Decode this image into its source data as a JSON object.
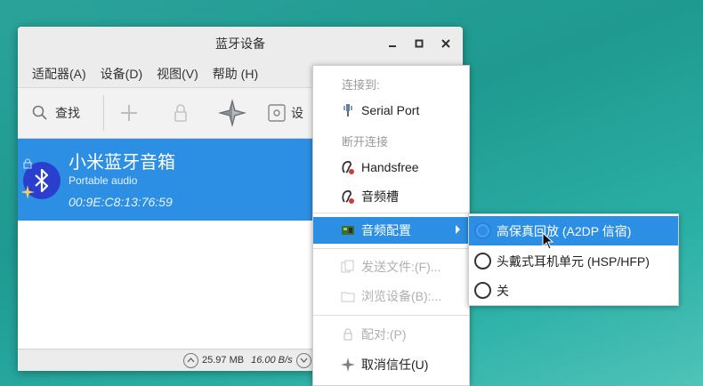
{
  "window": {
    "title": "蓝牙设备",
    "menubar": [
      "适配器(A)",
      "设备(D)",
      "视图(V)",
      "帮助 (H)"
    ],
    "toolbar": {
      "search_label": "查找",
      "setup_label": "设"
    },
    "device": {
      "name": "小米蓝牙音箱",
      "type": "Portable audio",
      "address": "00:9E:C8:13:76:59"
    },
    "status": {
      "size": "25.97 MB",
      "speed": "16.00 B/s"
    }
  },
  "context_menu": {
    "connect_to": "连接到:",
    "serial_port": "Serial Port",
    "disconnect": "断开连接",
    "handsfree": "Handsfree",
    "audio_sink": "音频槽",
    "audio_profile": "音频配置",
    "send_files": "发送文件:(F)...",
    "browse_device": "浏览设备(B):...",
    "pair": "配对:(P)",
    "untrust": "取消信任(U)"
  },
  "audio_submenu": {
    "options": [
      {
        "label": "高保真回放 (A2DP 信宿)",
        "selected": true
      },
      {
        "label": "头戴式耳机单元 (HSP/HFP)",
        "selected": false
      },
      {
        "label": "关",
        "selected": false
      }
    ]
  },
  "colors": {
    "accent": "#2c8fe3",
    "desktop": "#2aa39a",
    "bluetooth_circle": "#2a3fce"
  }
}
